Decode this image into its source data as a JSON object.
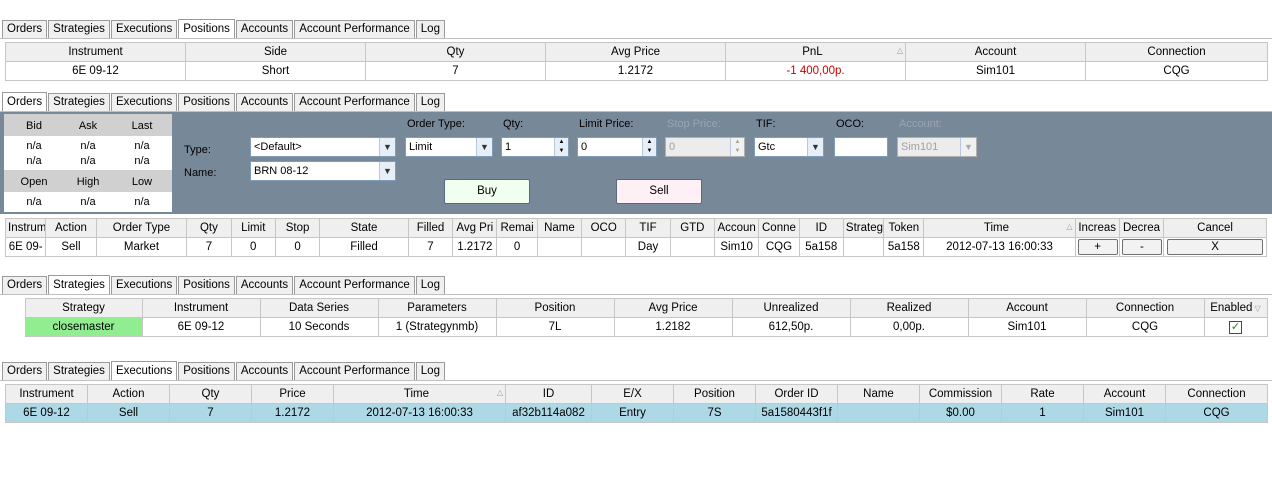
{
  "tabs": [
    "Orders",
    "Strategies",
    "Executions",
    "Positions",
    "Accounts",
    "Account Performance",
    "Log"
  ],
  "positions": {
    "headers": [
      "Instrument",
      "Side",
      "Qty",
      "Avg Price",
      "PnL",
      "Account",
      "Connection"
    ],
    "row": [
      "6E 09-12",
      "Short",
      "7",
      "1.2172",
      "-1 400,00p.",
      "Sim101",
      "CQG"
    ]
  },
  "orders": {
    "quote": {
      "h1": [
        "Bid",
        "Ask",
        "Last"
      ],
      "r1": [
        "n/a",
        "n/a",
        "n/a"
      ],
      "r2": [
        "n/a",
        "n/a",
        "n/a"
      ],
      "h2": [
        "Open",
        "High",
        "Low"
      ],
      "r3": [
        "n/a",
        "n/a",
        "n/a"
      ]
    },
    "form": {
      "type_label": "Type:",
      "name_label": "Name:",
      "type_value": "<Default>",
      "name_value": "BRN 08-12",
      "order_type_label": "Order Type:",
      "order_type_value": "Limit",
      "qty_label": "Qty:",
      "qty_value": "1",
      "limit_price_label": "Limit Price:",
      "limit_price_value": "0",
      "stop_price_label": "Stop Price:",
      "stop_price_value": "0",
      "tif_label": "TIF:",
      "tif_value": "Gtc",
      "oco_label": "OCO:",
      "oco_value": "",
      "account_label": "Account:",
      "account_value": "Sim101",
      "buy_label": "Buy",
      "sell_label": "Sell"
    },
    "headers": [
      "Instrum",
      "Action",
      "Order Type",
      "Qty",
      "Limit",
      "Stop",
      "State",
      "Filled",
      "Avg Pri",
      "Remai",
      "Name",
      "OCO",
      "TIF",
      "GTD",
      "Accoun",
      "Conne",
      "ID",
      "Strateg",
      "Token",
      "Time",
      "Increas",
      "Decrea",
      "Cancel"
    ],
    "row": [
      "6E 09-",
      "Sell",
      "Market",
      "7",
      "0",
      "0",
      "Filled",
      "7",
      "1.2172",
      "0",
      "",
      "",
      "Day",
      "",
      "Sim10",
      "CQG",
      "5a158",
      "",
      "5a158",
      "2012-07-13 16:00:33",
      "+",
      "-",
      "X"
    ]
  },
  "strategies": {
    "headers": [
      "Strategy",
      "Instrument",
      "Data Series",
      "Parameters",
      "Position",
      "Avg Price",
      "Unrealized",
      "Realized",
      "Account",
      "Connection",
      "Enabled"
    ],
    "row": [
      "closemaster",
      "6E 09-12",
      "10 Seconds",
      "1 (Strategynmb)",
      "7L",
      "1.2182",
      "612,50p.",
      "0,00p.",
      "Sim101",
      "CQG",
      "✓"
    ]
  },
  "executions": {
    "headers": [
      "Instrument",
      "Action",
      "Qty",
      "Price",
      "Time",
      "ID",
      "E/X",
      "Position",
      "Order ID",
      "Name",
      "Commission",
      "Rate",
      "Account",
      "Connection"
    ],
    "row": [
      "6E 09-12",
      "Sell",
      "7",
      "1.2172",
      "2012-07-13 16:00:33",
      "af32b114a082",
      "Entry",
      "7S",
      "5a1580443f1f",
      "",
      "$0.00",
      "1",
      "Sim101",
      "CQG"
    ]
  },
  "colors": {
    "panel_bg": "#778899",
    "strategy_green": "#90ee90",
    "selected_row": "#add8e6",
    "buy_button": "#f0fff0",
    "sell_button": "#fff0f5",
    "pnl_negative": "#cc0000"
  }
}
